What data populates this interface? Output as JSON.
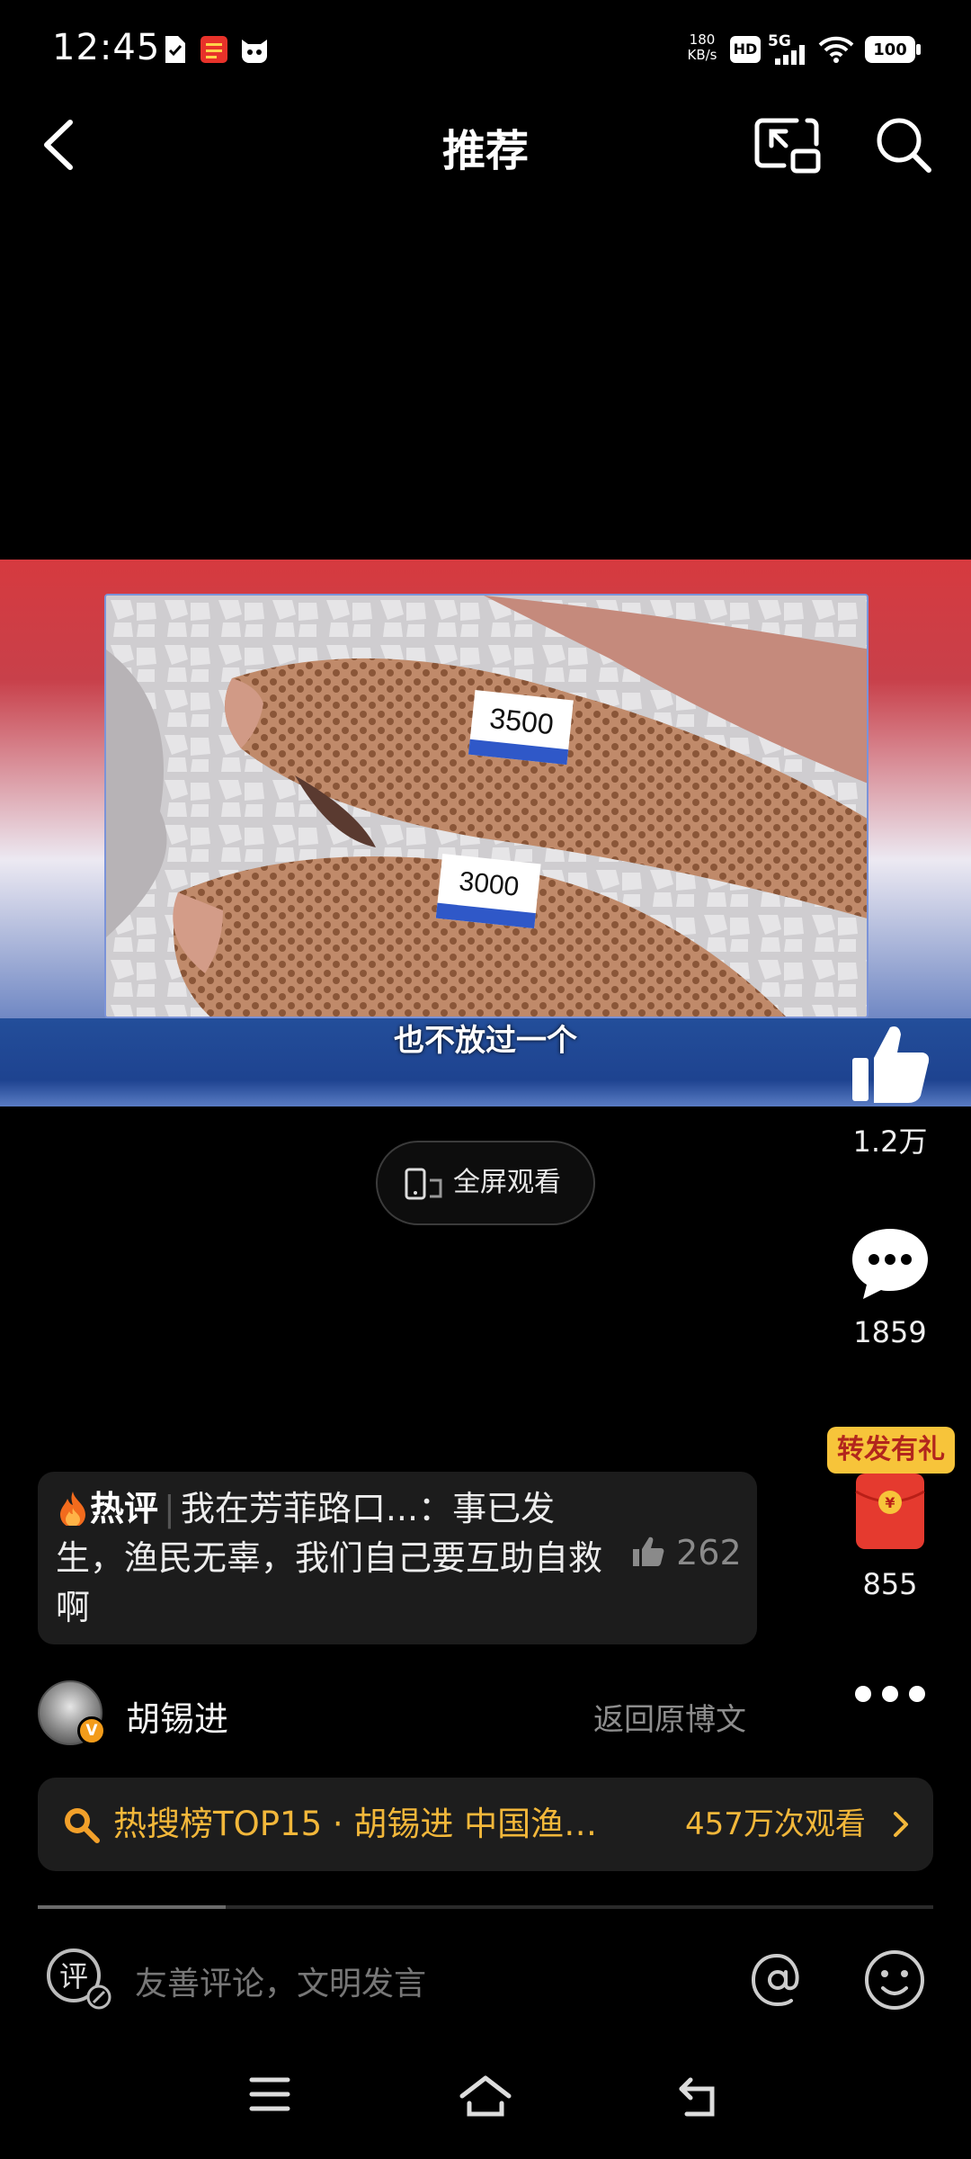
{
  "status_bar": {
    "time": "12:45",
    "net_speed_value": "180",
    "net_speed_unit": "KB/s",
    "hd_label": "HD",
    "network": "5G",
    "battery": "100",
    "icons": [
      "sim-notification-icon",
      "shop-notification-icon",
      "cat-app-icon",
      "signal-icon",
      "wifi-icon"
    ]
  },
  "header": {
    "title": "推荐",
    "back_icon": "chevron-left-icon",
    "pip_icon": "picture-in-picture-icon",
    "search_icon": "search-icon"
  },
  "video": {
    "subtitle": "也不放过一个",
    "price_tag_1": "3500",
    "price_tag_2": "3000"
  },
  "fullscreen_button": {
    "label": "全屏观看"
  },
  "right_rail": {
    "likes": "1.2万",
    "comments": "1859",
    "repost_badge": "转发有礼",
    "reposts": "855"
  },
  "hot_comment": {
    "label": "热评",
    "author": "我在芳菲路口...",
    "text": "：事已发生，渔民无辜，我们自己要互助自救啊",
    "likes": "262"
  },
  "author_row": {
    "name": "胡锡进",
    "back_link": "返回原博文",
    "verified_badge": "V"
  },
  "trending": {
    "text": "热搜榜TOP15 · 胡锡进 中国渔…",
    "views": "457万次观看"
  },
  "playback": {
    "progress_fraction": 0.21
  },
  "comment_bar": {
    "placeholder": "友善评论，文明发言",
    "comment_glyph": "评"
  },
  "colors": {
    "accent_gold": "#f2b73a",
    "repost_badge_bg": "#f7c43a",
    "red_packet": "#e53a2f",
    "background": "#000000"
  }
}
